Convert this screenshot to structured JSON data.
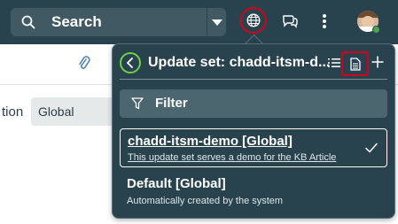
{
  "header": {
    "search_label": "Search",
    "icons": [
      "search-icon",
      "chevron-down-icon",
      "globe-icon",
      "chat-icon",
      "kebab-icon",
      "avatar"
    ]
  },
  "background": {
    "field_label": "tion",
    "field_value": "Global"
  },
  "popover": {
    "title": "Update set: chadd-itsm-d...",
    "filter_placeholder": "Filter",
    "items": [
      {
        "name": "chadd-itsm-demo [Global]",
        "description": "This update set serves a demo for the KB Article",
        "selected": true
      },
      {
        "name": "Default [Global]",
        "description": "Automatically created by the system",
        "selected": false
      }
    ]
  },
  "colors": {
    "header_bg": "#29434e",
    "highlight_ring": "#d0021b",
    "back_ring": "#6fcf4a",
    "status_online": "#4aa84a"
  }
}
